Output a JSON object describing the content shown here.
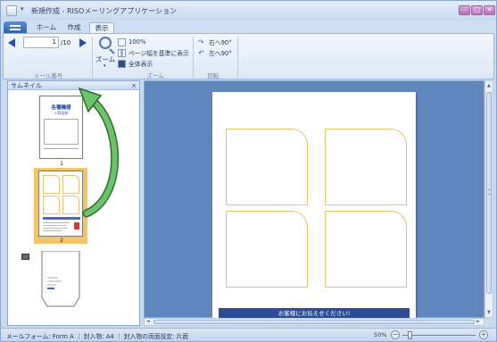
{
  "window": {
    "title": "新規作成 - RISOメーリングアプリケーション",
    "qa_arrow": "▾",
    "min_glyph": "–",
    "max_glyph": "□",
    "close_glyph": "✕"
  },
  "ribbon": {
    "tabs": {
      "home": "ホーム",
      "create": "作成",
      "view": "表示"
    },
    "mail_number": {
      "current": "1",
      "total": "/10",
      "group_label": "メール番号"
    },
    "zoom": {
      "button_label": "ズーム",
      "caret": "▾",
      "percent_100": "100%",
      "fit_width": "ページ幅を基準に表示",
      "fit_page": "全体表示",
      "group_label": "ズーム"
    },
    "rotate": {
      "right": "右へ90°",
      "left": "左へ90°",
      "group_label": "回転"
    }
  },
  "sidebar": {
    "header": "サムネイル",
    "close_glyph": "×",
    "thumbnails": [
      {
        "number": "1",
        "title": "各種機器",
        "subtitle": "入荷告知"
      },
      {
        "number": "2"
      }
    ]
  },
  "canvas": {
    "banner_text": "お客様にお伝えせください!"
  },
  "scrollbars": {
    "up": "▲",
    "down": "▼",
    "left": "◄",
    "right": "►"
  },
  "statusbar": {
    "text": "メールフォーム: Form A  ｜ 封入物: A4  ｜ 封入物の両面設定: 片面",
    "zoom_percent": "50%",
    "zoom_fraction": 0.1,
    "minus_glyph": "−",
    "plus_glyph": "+"
  },
  "colors": {
    "accent_orange": "#f4c36b",
    "arrow_green": "#3f9e3c",
    "canvas_blue": "#5f86bd",
    "banner_navy": "#2d4d98"
  }
}
